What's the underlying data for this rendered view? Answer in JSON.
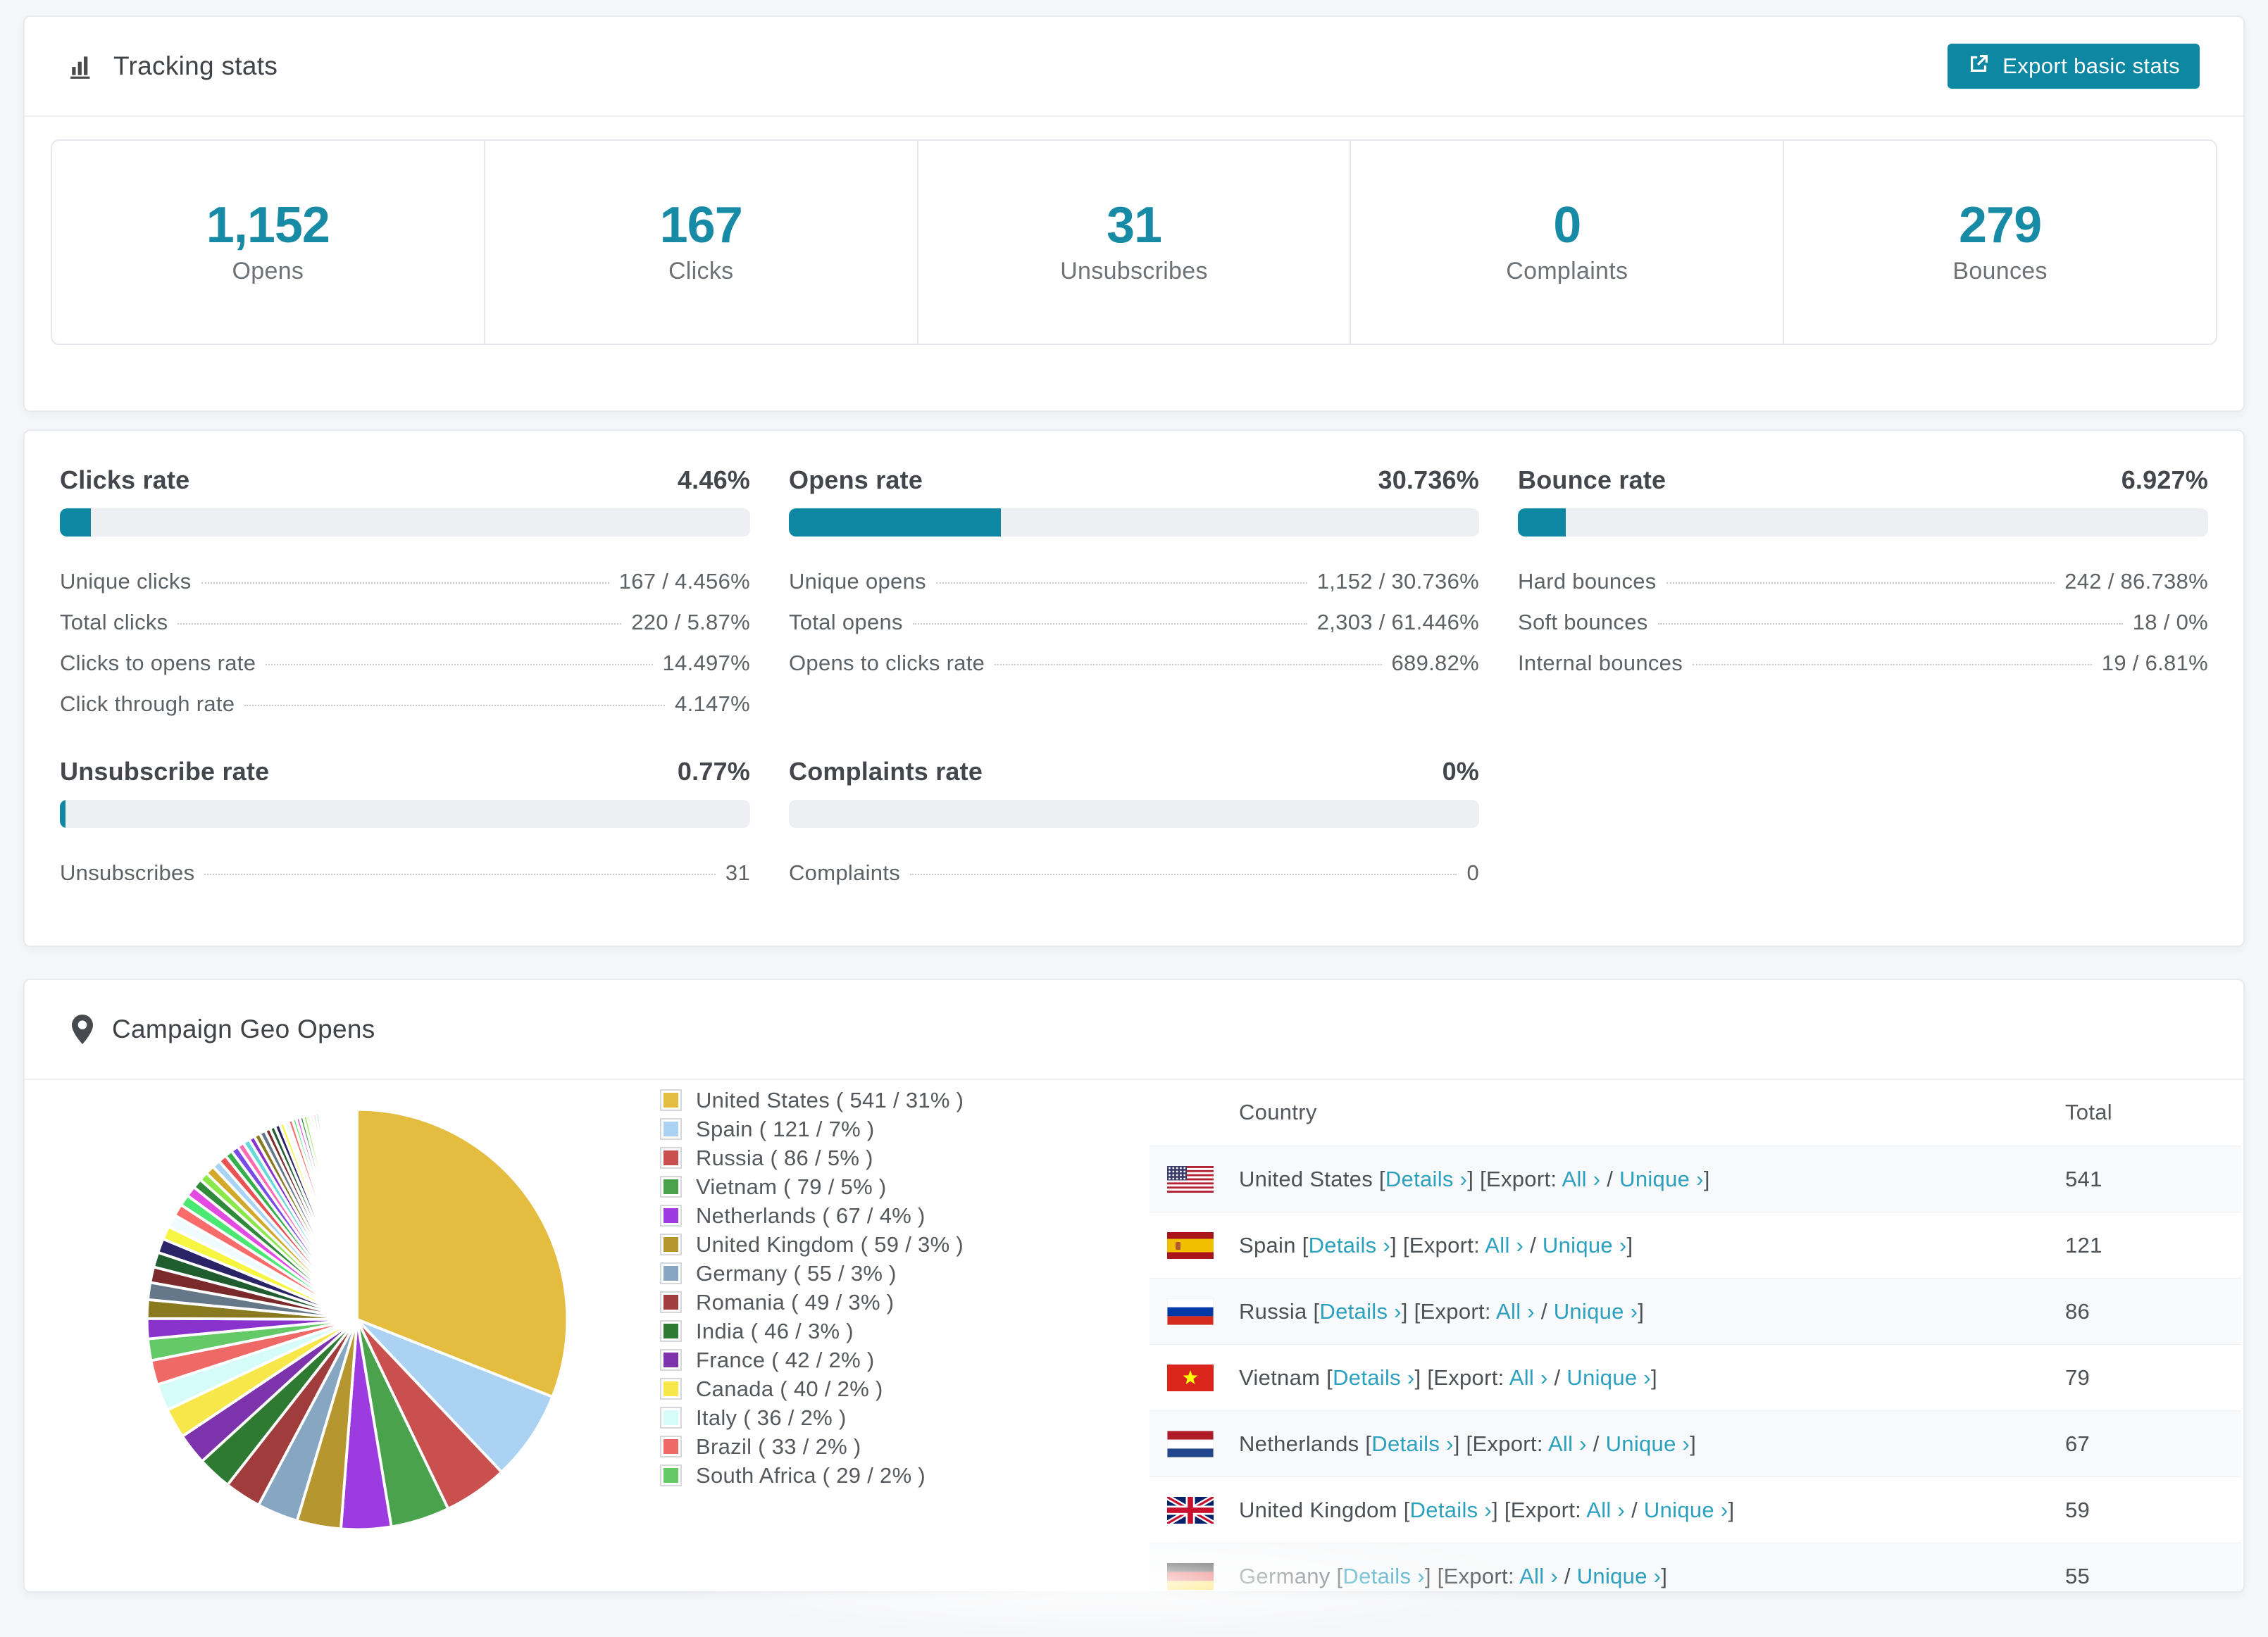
{
  "colors": {
    "accent": "#178ba6",
    "bar_fill": "#0d87a2",
    "button_bg": "#0d87a2",
    "link": "#2ba0bf"
  },
  "tracking": {
    "title": "Tracking stats",
    "export_button": "Export basic stats",
    "stats": [
      {
        "value": "1,152",
        "label": "Opens"
      },
      {
        "value": "167",
        "label": "Clicks"
      },
      {
        "value": "31",
        "label": "Unsubscribes"
      },
      {
        "value": "0",
        "label": "Complaints"
      },
      {
        "value": "279",
        "label": "Bounces"
      }
    ]
  },
  "rates": [
    {
      "title": "Clicks rate",
      "value": "4.46%",
      "percent": 4.46,
      "rows": [
        {
          "label": "Unique clicks",
          "value": "167 / 4.456%"
        },
        {
          "label": "Total clicks",
          "value": "220 / 5.87%"
        },
        {
          "label": "Clicks to opens rate",
          "value": "14.497%"
        },
        {
          "label": "Click through rate",
          "value": "4.147%"
        }
      ]
    },
    {
      "title": "Opens rate",
      "value": "30.736%",
      "percent": 30.736,
      "rows": [
        {
          "label": "Unique opens",
          "value": "1,152 / 30.736%"
        },
        {
          "label": "Total opens",
          "value": "2,303 / 61.446%"
        },
        {
          "label": "Opens to clicks rate",
          "value": "689.82%"
        }
      ]
    },
    {
      "title": "Bounce rate",
      "value": "6.927%",
      "percent": 6.927,
      "rows": [
        {
          "label": "Hard bounces",
          "value": "242 / 86.738%"
        },
        {
          "label": "Soft bounces",
          "value": "18 / 0%"
        },
        {
          "label": "Internal bounces",
          "value": "19 / 6.81%"
        }
      ]
    },
    {
      "title": "Unsubscribe rate",
      "value": "0.77%",
      "percent": 0.77,
      "rows": [
        {
          "label": "Unsubscribes",
          "value": "31"
        }
      ]
    },
    {
      "title": "Complaints rate",
      "value": "0%",
      "percent": 0,
      "rows": [
        {
          "label": "Complaints",
          "value": "0"
        }
      ]
    }
  ],
  "geo": {
    "title": "Campaign Geo Opens",
    "columns": [
      "Country",
      "Total"
    ],
    "links": {
      "details": "Details ›",
      "export_prefix": "Export:",
      "all": "All ›",
      "unique": "Unique ›",
      "slash": "/"
    },
    "rows": [
      {
        "country": "United States",
        "flag": "us",
        "total": "541"
      },
      {
        "country": "Spain",
        "flag": "es",
        "total": "121"
      },
      {
        "country": "Russia",
        "flag": "ru",
        "total": "86"
      },
      {
        "country": "Vietnam",
        "flag": "vn",
        "total": "79"
      },
      {
        "country": "Netherlands",
        "flag": "nl",
        "total": "67"
      },
      {
        "country": "United Kingdom",
        "flag": "gb",
        "total": "59"
      },
      {
        "country": "Germany",
        "flag": "de",
        "total": "55"
      }
    ]
  },
  "chart_data": {
    "type": "pie",
    "title": "Campaign Geo Opens",
    "legend_position": "right",
    "start_angle_deg": -90,
    "direction": "clockwise",
    "series": [
      {
        "name": "United States",
        "value": 541,
        "pct_label": "31%",
        "color": "#e4bc3f"
      },
      {
        "name": "Spain",
        "value": 121,
        "pct_label": "7%",
        "color": "#abd2f2"
      },
      {
        "name": "Russia",
        "value": 86,
        "pct_label": "5%",
        "color": "#c9504f"
      },
      {
        "name": "Vietnam",
        "value": 79,
        "pct_label": "5%",
        "color": "#4aa24c"
      },
      {
        "name": "Netherlands",
        "value": 67,
        "pct_label": "4%",
        "color": "#9b3be0"
      },
      {
        "name": "United Kingdom",
        "value": 59,
        "pct_label": "3%",
        "color": "#b5962f"
      },
      {
        "name": "Germany",
        "value": 55,
        "pct_label": "3%",
        "color": "#86a6c2"
      },
      {
        "name": "Romania",
        "value": 49,
        "pct_label": "3%",
        "color": "#a03c3c"
      },
      {
        "name": "India",
        "value": 46,
        "pct_label": "3%",
        "color": "#2f7a33"
      },
      {
        "name": "France",
        "value": 42,
        "pct_label": "2%",
        "color": "#7c33ab"
      },
      {
        "name": "Canada",
        "value": 40,
        "pct_label": "2%",
        "color": "#f7e74b"
      },
      {
        "name": "Italy",
        "value": 36,
        "pct_label": "2%",
        "color": "#d5fcf9"
      },
      {
        "name": "Brazil",
        "value": 33,
        "pct_label": "2%",
        "color": "#ef6a66"
      },
      {
        "name": "South Africa",
        "value": 29,
        "pct_label": "2%",
        "color": "#63ca67"
      }
    ],
    "other_slices": {
      "values": [
        27,
        25,
        23,
        21,
        20,
        19,
        18,
        17,
        16,
        15,
        14,
        13,
        12,
        12,
        11,
        11,
        10,
        10,
        9,
        9,
        8,
        8,
        8,
        7,
        7,
        7,
        6,
        6,
        6,
        5,
        5,
        5,
        5,
        4,
        4,
        4,
        4,
        3,
        3,
        3,
        3,
        3,
        2,
        2,
        2,
        2,
        2,
        2,
        2,
        2,
        1,
        1,
        1,
        1,
        1,
        1,
        1,
        1,
        1,
        1,
        1,
        1,
        1,
        1,
        1,
        1,
        1,
        1,
        1,
        1
      ],
      "palette": [
        "#8a33cc",
        "#8a7a1f",
        "#64788a",
        "#7a2a2a",
        "#1f5c2e",
        "#2a2366",
        "#f5f542",
        "#effbff",
        "#fa6b6b",
        "#4ae873",
        "#e24ae2",
        "#2f8a3c",
        "#8ae84a",
        "#d3a92c",
        "#a9d3f5",
        "#e85252",
        "#33b04a",
        "#7a4ae8",
        "#ff6bb0",
        "#66d9d9"
      ]
    }
  }
}
